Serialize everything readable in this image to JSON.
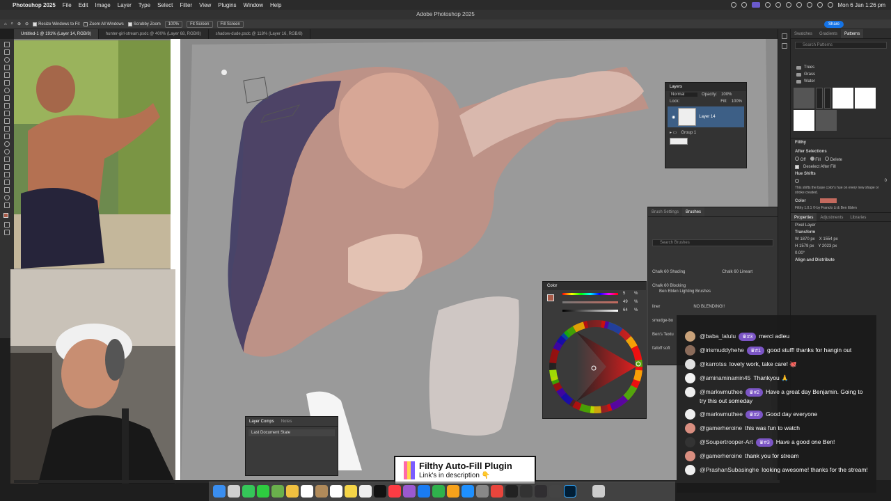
{
  "menubar": {
    "app": "Photoshop 2025",
    "items": [
      "File",
      "Edit",
      "Image",
      "Layer",
      "Type",
      "Select",
      "Filter",
      "View",
      "Plugins",
      "Window",
      "Help"
    ],
    "clock": "Mon 6 Jan  1:26 pm"
  },
  "window": {
    "title": "Adobe Photoshop 2025"
  },
  "options": {
    "resize_windows": "Resize Windows to Fit",
    "zoom_all": "Zoom All Windows",
    "scrubby_zoom": "Scrubby Zoom",
    "zoom_value": "100%",
    "fit_screen": "Fit Screen",
    "fill_screen": "Fill Screen",
    "share": "Share"
  },
  "tabs": [
    {
      "label": "Untitled-1 @ 191% (Layer 14, RGB/8)"
    },
    {
      "label": "hunter-girl-stream.psdc @ 400% (Layer 68, RGB/8)"
    },
    {
      "label": "shadow-dude.psdc @ 118% (Layer 16, RGB/8)"
    }
  ],
  "right_panel": {
    "tabs": [
      "Swatches",
      "Gradients",
      "Patterns"
    ],
    "search_placeholder": "Search Patterns",
    "folders": [
      "Trees",
      "Grass",
      "Water"
    ],
    "filthy": {
      "title": "Filthy",
      "after_selections": "After Selections",
      "off": "Off",
      "fill": "Fill",
      "delete": "Delete",
      "deselect_after_fill": "Deselect After Fill",
      "hue_shifts": "Hue Shifts",
      "hue_value": "0",
      "hue_desc": "This shifts the base color's hue on every new shape or stroke created.",
      "color_label": "Color",
      "credit": "Filthy 1.0.1 © by Franclo Li & Ben Eblen"
    },
    "props_tabs": [
      "Properties",
      "Adjustments",
      "Libraries"
    ],
    "pixel_layer": "Pixel Layer",
    "transform": "Transform",
    "w": "W  1870 px",
    "x": "X  1554 px",
    "h": "H  1579 px",
    "y": "Y  2023 px",
    "angle": "0.00°",
    "align": "Align and Distribute"
  },
  "layers_panel": {
    "title": "Layers",
    "blend": "Normal",
    "opacity_label": "Opacity:",
    "opacity": "100%",
    "lock_label": "Lock:",
    "fill_label": "Fill:",
    "fill": "100%",
    "layer_name": "Layer 14",
    "group_name": "Group 1"
  },
  "brushes_panel": {
    "tabs": [
      "Brush Settings",
      "Brushes"
    ],
    "search_placeholder": "Search Brushes",
    "brushes": [
      "Chalk 60 Shading",
      "Chalk 60 Lineart",
      "Chalk 60 Blocking"
    ],
    "group": "Ben Eblen Lighting Brushes",
    "liner": "liner",
    "no_blending": "NO BLENDING!!",
    "smudge": "smudge-bo",
    "bens": "Ben's Textu",
    "falloff": "falloff soft"
  },
  "color_panel": {
    "title": "Color",
    "h": "5",
    "s": "49",
    "b": "64",
    "unit": "%"
  },
  "layer_comps": {
    "tabs": [
      "Layer Comps",
      "Notes"
    ],
    "item": "Last Document State"
  },
  "chat": [
    {
      "user": "@baba_lalulu",
      "badge": "#3",
      "text": "merci adieu",
      "av": "#c9a27a"
    },
    {
      "user": "@irismuddyhehe",
      "badge": "#1",
      "text": "good stuff! thanks for hangin out",
      "av": "#8a6b5a"
    },
    {
      "user": "@karrotss",
      "badge": "",
      "text": "lovely work, take care! 🐙",
      "av": "#e0e0e0"
    },
    {
      "user": "@aminaminamin45",
      "badge": "",
      "text": "Thankyou 🙏",
      "av": "#f2f2f2"
    },
    {
      "user": "@markwmuthee",
      "badge": "#2",
      "text": "Have a great day Benjamin. Going to try this out someday",
      "av": "#eeeeee"
    },
    {
      "user": "@markwmuthee",
      "badge": "#2",
      "text": "Good day everyone",
      "av": "#eeeeee"
    },
    {
      "user": "@gamerheroine",
      "badge": "",
      "text": "this was fun to watch",
      "av": "#d98e80"
    },
    {
      "user": "@Soupertrooper-Art",
      "badge": "#3",
      "text": "Have a good one Ben!",
      "av": "#333333"
    },
    {
      "user": "@gamerheroine",
      "badge": "",
      "text": "thank you for stream",
      "av": "#d98e80"
    },
    {
      "user": "@PrashanSubasinghe",
      "badge": "",
      "text": "looking awesome! thanks for the stream!",
      "av": "#f0f0f0"
    }
  ],
  "promo": {
    "title": "Filthy Auto-Fill Plugin",
    "subtitle": "Link's in description 👇"
  },
  "colors": {
    "accent": "#1473e6",
    "badge": "#7b55c5",
    "foreground": "#a85a48",
    "selected_layer": "#3d5f86"
  }
}
